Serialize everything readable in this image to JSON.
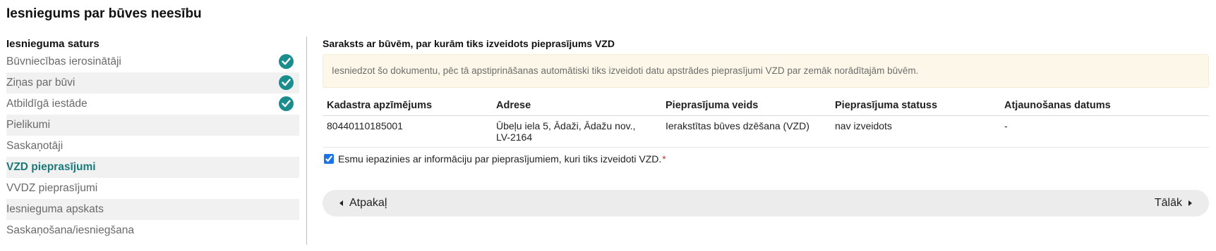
{
  "page": {
    "title": "Iesniegums par būves neesību"
  },
  "sidebar": {
    "heading": "Iesnieguma saturs",
    "items": [
      {
        "label": "Būvniecības ierosinātāji",
        "completed": true
      },
      {
        "label": "Ziņas par būvi",
        "completed": true
      },
      {
        "label": "Atbildīgā iestāde",
        "completed": true
      },
      {
        "label": "Pielikumi",
        "completed": false
      },
      {
        "label": "Saskaņotāji",
        "completed": false
      },
      {
        "label": "VZD pieprasījumi",
        "completed": false,
        "active": true
      },
      {
        "label": "VVDZ pieprasījumi",
        "completed": false
      },
      {
        "label": "Iesnieguma apskats",
        "completed": false
      },
      {
        "label": "Saskaņošana/iesniegšana",
        "completed": false
      }
    ]
  },
  "main": {
    "section_title": "Saraksts ar būvēm, par kurām tiks izveidots pieprasījums VZD",
    "notice": "Iesniedzot šo dokumentu, pēc tā apstiprināšanas automātiski tiks izveidoti datu apstrādes pieprasījumi VZD par zemāk norādītajām būvēm.",
    "table": {
      "headers": [
        "Kadastra apzīmējums",
        "Adrese",
        "Pieprasījuma veids",
        "Pieprasījuma statuss",
        "Atjaunošanas datums"
      ],
      "rows": [
        [
          "80440110185001",
          "Ūbeļu iela 5, Ādaži, Ādažu nov., LV-2164",
          "Ierakstītas būves dzēšana (VZD)",
          "nav izveidots",
          "-"
        ]
      ]
    },
    "consent": {
      "label": "Esmu iepazinies ar informāciju par pieprasījumiem, kuri tiks izveidoti VZD.",
      "required_mark": "*",
      "checked": true
    },
    "navigation": {
      "back_label": "Atpakaļ",
      "next_label": "Tālāk"
    }
  },
  "colors": {
    "accent": "#1b8d8d",
    "active_text": "#1a7a7a",
    "notice_bg": "#fcf7e8"
  },
  "icons": {
    "completed": "check-circle-icon",
    "back": "caret-left-icon",
    "next": "caret-right-icon"
  }
}
